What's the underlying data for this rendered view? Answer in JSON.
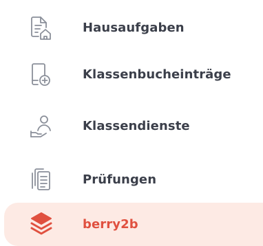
{
  "sidebar": {
    "items": [
      {
        "label": "Hausaufgaben",
        "icon": "homework-icon",
        "active": false
      },
      {
        "label": "Klassenbucheinträge",
        "icon": "class-register-add-icon",
        "active": false
      },
      {
        "label": "Klassendienste",
        "icon": "class-duty-icon",
        "active": false
      },
      {
        "label": "Prüfungen",
        "icon": "exams-icon",
        "active": false
      },
      {
        "label": "berry2b",
        "icon": "layers-icon",
        "active": true
      }
    ]
  },
  "colors": {
    "text": "#3b3f4a",
    "icon": "#8a8f99",
    "accent": "#e0503f",
    "active_bg": "#fdeae4"
  }
}
